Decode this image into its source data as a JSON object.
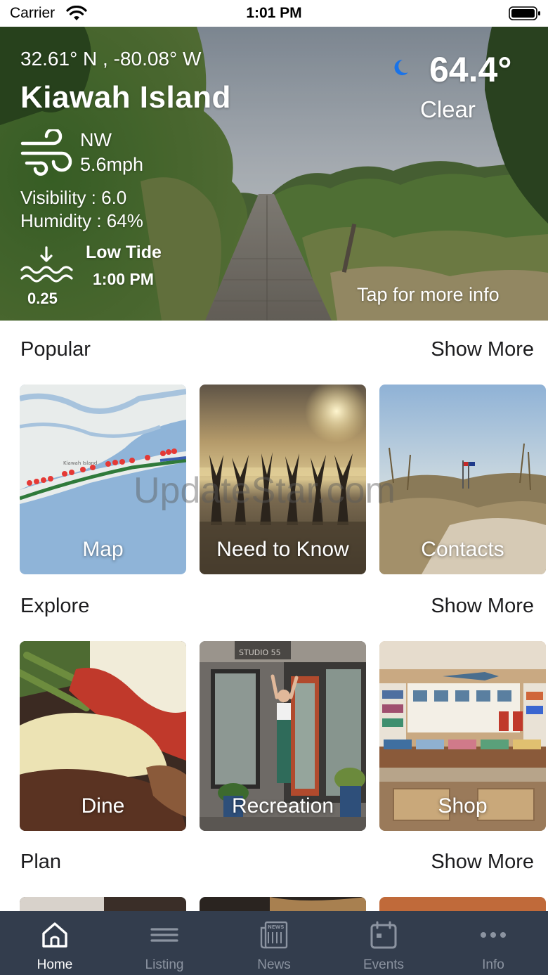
{
  "status_bar": {
    "carrier": "Carrier",
    "time": "1:01 PM",
    "icons": [
      "wifi-icon",
      "battery-icon"
    ]
  },
  "weather": {
    "coordinates": "32.61° N , -80.08° W",
    "location": "Kiawah Island",
    "wind_direction": "NW",
    "wind_speed": "5.6mph",
    "visibility": "Visibility : 6.0",
    "humidity": "Humidity : 64%",
    "tide_value": "0.25",
    "tide_label": "Low Tide",
    "tide_time": "1:00 PM",
    "temperature": "64.4°",
    "condition": "Clear",
    "tap_hint": "Tap for more info",
    "moon_color": "#1a73e8"
  },
  "sections": [
    {
      "title": "Popular",
      "show_more": "Show More",
      "cards": [
        {
          "label": "Map"
        },
        {
          "label": "Need to Know"
        },
        {
          "label": "Contacts"
        }
      ]
    },
    {
      "title": "Explore",
      "show_more": "Show More",
      "cards": [
        {
          "label": "Dine"
        },
        {
          "label": "Recreation"
        },
        {
          "label": "Shop"
        }
      ]
    },
    {
      "title": "Plan",
      "show_more": "Show More",
      "cards": []
    }
  ],
  "watermark": "UpdateStar.com",
  "tab_bar": {
    "tabs": [
      {
        "label": "Home",
        "icon": "home-icon",
        "active": true
      },
      {
        "label": "Listing",
        "icon": "listing-icon",
        "active": false
      },
      {
        "label": "News",
        "icon": "news-icon",
        "active": false
      },
      {
        "label": "Events",
        "icon": "calendar-icon",
        "active": false
      },
      {
        "label": "Info",
        "icon": "more-icon",
        "active": false
      }
    ],
    "background": "#333d4d"
  }
}
